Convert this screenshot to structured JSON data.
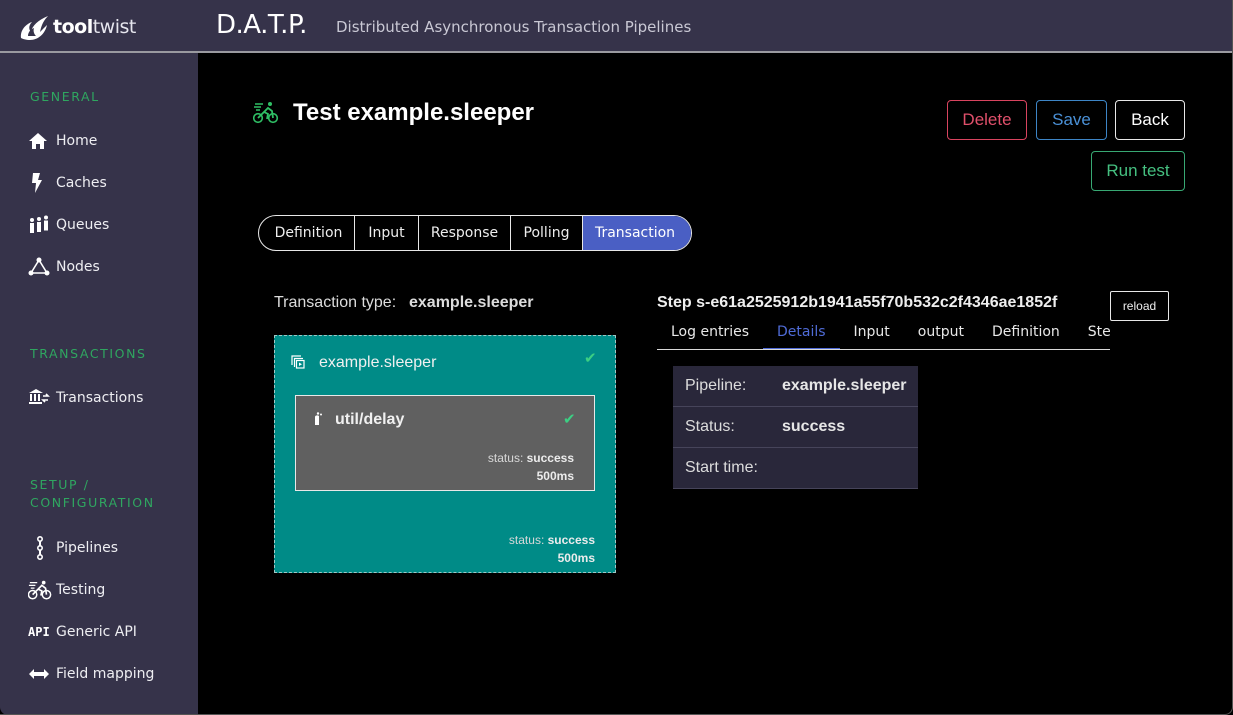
{
  "header": {
    "logo_bold": "tool",
    "logo_light": "twist",
    "app_title": "D.A.T.P.",
    "app_subtitle": "Distributed Asynchronous Transaction Pipelines"
  },
  "sidebar": {
    "sections": [
      {
        "label": "GENERAL"
      },
      {
        "label": "TRANSACTIONS"
      },
      {
        "label": "SETUP /\nCONFIGURATION"
      }
    ],
    "items": [
      {
        "label": "Home",
        "icon": "home-icon"
      },
      {
        "label": "Caches",
        "icon": "lightning-icon"
      },
      {
        "label": "Queues",
        "icon": "people-icon"
      },
      {
        "label": "Nodes",
        "icon": "nodes-icon"
      },
      {
        "label": "Transactions",
        "icon": "bank-transfer-icon"
      },
      {
        "label": "Pipelines",
        "icon": "pipeline-icon"
      },
      {
        "label": "Testing",
        "icon": "cyclist-icon"
      },
      {
        "label": "Generic API",
        "icon": "api-icon"
      },
      {
        "label": "Field mapping",
        "icon": "arrows-horizontal-icon"
      }
    ]
  },
  "page": {
    "title": "Test example.sleeper",
    "buttons": {
      "delete": "Delete",
      "save": "Save",
      "back": "Back",
      "run_test": "Run test"
    },
    "tabs": [
      {
        "label": "Definition",
        "active": false
      },
      {
        "label": "Input",
        "active": false
      },
      {
        "label": "Response",
        "active": false
      },
      {
        "label": "Polling",
        "active": false
      },
      {
        "label": "Transaction",
        "active": true
      }
    ]
  },
  "transaction": {
    "type_label": "Transaction type:",
    "type_value": "example.sleeper",
    "pipeline": {
      "name": "example.sleeper",
      "status_label": "status:",
      "status": "success",
      "duration": "500ms",
      "steps": [
        {
          "name": "util/delay",
          "status_label": "status:",
          "status": "success",
          "duration": "500ms"
        }
      ]
    }
  },
  "step_panel": {
    "title": "Step s-e61a2525912b1941a55f70b532c2f4346ae1852f",
    "reload_label": "reload",
    "tabs": [
      {
        "label": "Log entries",
        "active": false
      },
      {
        "label": "Details",
        "active": true
      },
      {
        "label": "Input",
        "active": false
      },
      {
        "label": "output",
        "active": false
      },
      {
        "label": "Definition",
        "active": false
      },
      {
        "label": "StepData",
        "active": false
      }
    ],
    "details": [
      {
        "label": "Pipeline:",
        "value": "example.sleeper"
      },
      {
        "label": "Status:",
        "value": "success"
      },
      {
        "label": "Start time:",
        "value": ""
      }
    ]
  },
  "colors": {
    "accent": "#4a5fc4",
    "section_label": "#2fa660",
    "pipeline_bg": "#008b87",
    "step_bg": "#606060",
    "delete": "#d9445f",
    "save": "#3d85c6",
    "run": "#38a873",
    "check": "#3ccf83"
  }
}
